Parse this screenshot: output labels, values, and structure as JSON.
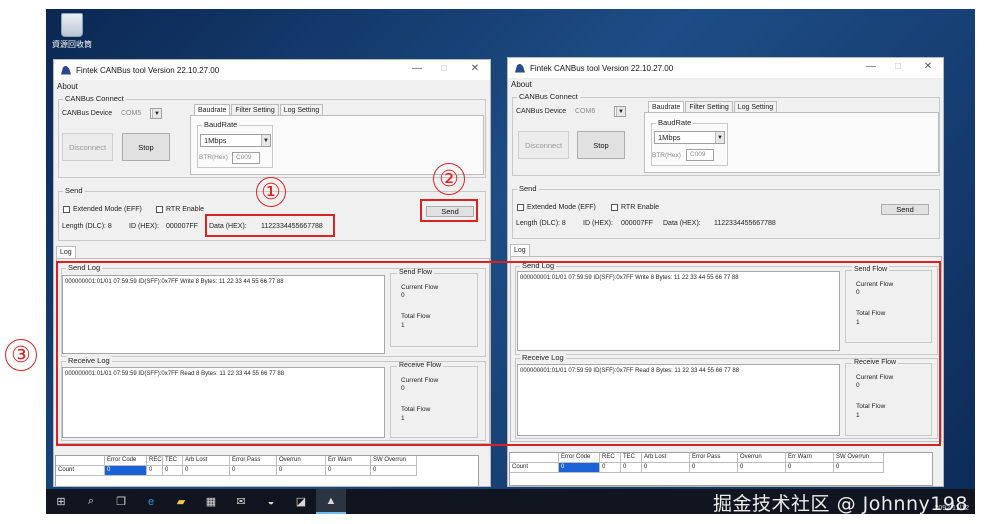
{
  "desktop": {
    "recycle_label": "資源回收筒"
  },
  "windows": [
    {
      "title": "Fintek CANBus tool Version 22.10.27.00",
      "menu": "About",
      "connect_group": "CANBus Connect",
      "device_label": "CANBus Device",
      "device_value": "COM5",
      "disconnect_label": "Disconnect",
      "stop_label": "Stop",
      "tabs": [
        "Baudrate",
        "Filter Setting",
        "Log Setting"
      ],
      "baud_group": "BaudRate",
      "baud_value": "1Mbps",
      "btr_label": "BTR(Hex)",
      "btr_value": "C009",
      "send_group": "Send",
      "ext_mode": "Extended Mode (EFF)",
      "rtr": "RTR Enable",
      "dlc_text": "Length (DLC):  8",
      "id_label": "ID (HEX):",
      "id_value": "000007FF",
      "data_label": "Data (HEX):",
      "data_value": "1122334455667788",
      "send_btn": "Send",
      "log_tab": "Log",
      "send_log_cap": "Send Log",
      "send_log_text": "000000001:01/01 07:59:59 ID(SFF):0x7FF Write 8 Bytes: 11 22 33 44 55 66 77 88",
      "send_flow_cap": "Send Flow",
      "recv_log_cap": "Receive Log",
      "recv_log_text": "000000001:01/01 07:59:59 ID(SFF):0x7FF Read 8 Bytes: 11 22 33 44 55 66 77 88",
      "recv_flow_cap": "Receive Flow",
      "current_flow": "Current Flow",
      "total_flow": "Total Flow",
      "send_current": "0",
      "send_total": "1",
      "recv_current": "0",
      "recv_total": "1",
      "table_headers": [
        "",
        "Error Code",
        "REC",
        "TEC",
        "Arb Lost",
        "Error Pass",
        "Overrun",
        "Err Warn",
        "SW Overrun"
      ],
      "table_row": [
        "Count",
        "0",
        "0",
        "0",
        "0",
        "0",
        "0",
        "0",
        "0"
      ]
    },
    {
      "title": "Fintek CANBus tool Version 22.10.27.00",
      "menu": "About",
      "connect_group": "CANBus Connect",
      "device_label": "CANBus Device",
      "device_value": "COM6",
      "disconnect_label": "Disconnect",
      "stop_label": "Stop",
      "tabs": [
        "Baudrate",
        "Filter Setting",
        "Log Setting"
      ],
      "baud_group": "BaudRate",
      "baud_value": "1Mbps",
      "btr_label": "BTR(Hex)",
      "btr_value": "C009",
      "send_group": "Send",
      "ext_mode": "Extended Mode (EFF)",
      "rtr": "RTR Enable",
      "dlc_text": "Length (DLC):  8",
      "id_label": "ID (HEX):",
      "id_value": "000007FF",
      "data_label": "Data (HEX):",
      "data_value": "1122334455667788",
      "send_btn": "Send",
      "log_tab": "Log",
      "send_log_cap": "Send Log",
      "send_log_text": "000000001:01/01 07:59:59 ID(SFF):0x7FF Write 8 Bytes: 11 22 33 44 55 66 77 88",
      "send_flow_cap": "Send Flow",
      "recv_log_cap": "Receive Log",
      "recv_log_text": "000000001:01/01 07:59:59 ID(SFF):0x7FF Read 8 Bytes: 11 22 33 44 55 66 77 88",
      "recv_flow_cap": "Receive Flow",
      "current_flow": "Current Flow",
      "total_flow": "Total Flow",
      "send_current": "0",
      "send_total": "1",
      "recv_current": "0",
      "recv_total": "1",
      "table_headers": [
        "",
        "Error Code",
        "REC",
        "TEC",
        "Arb Lost",
        "Error Pass",
        "Overrun",
        "Err Warn",
        "SW Overrun"
      ],
      "table_row": [
        "Count",
        "0",
        "0",
        "0",
        "0",
        "0",
        "0",
        "0",
        "0"
      ]
    }
  ],
  "annotations": {
    "one": "①",
    "two": "②",
    "three": "③"
  },
  "taskbar": {
    "clock": "2092/11/12"
  },
  "watermark": "掘金技术社区 @ Johnny198",
  "colors": {
    "annotation": "#d92323",
    "selection": "#1a63d6",
    "taskbar": "#10151f"
  }
}
